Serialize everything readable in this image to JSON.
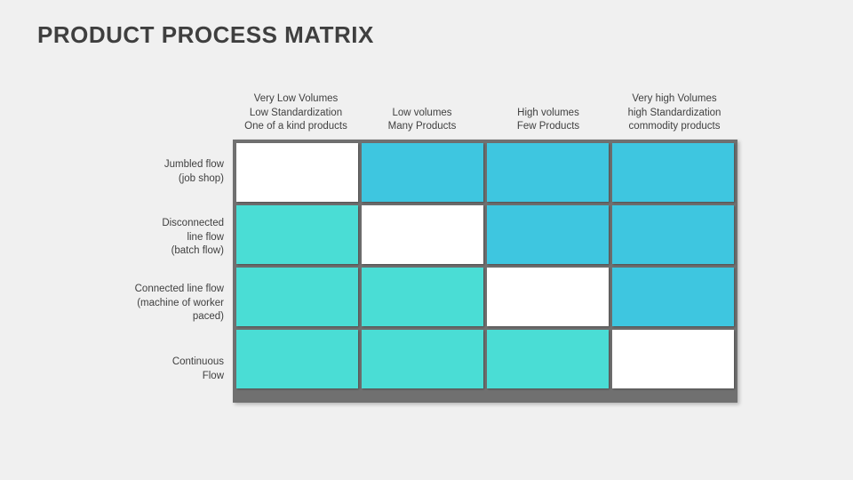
{
  "title": "PRODUCT PROCESS MATRIX",
  "columns": [
    {
      "l1": "Very Low Volumes",
      "l2": "Low Standardization",
      "l3": "One of a kind products"
    },
    {
      "l1": "Low volumes",
      "l2": "Many Products",
      "l3": ""
    },
    {
      "l1": "High volumes",
      "l2": "Few Products",
      "l3": ""
    },
    {
      "l1": "Very high Volumes",
      "l2": "high Standardization",
      "l3": "commodity products"
    }
  ],
  "rows": [
    {
      "l1": "Jumbled flow",
      "l2": "(job shop)",
      "l3": ""
    },
    {
      "l1": "Disconnected",
      "l2": "line flow",
      "l3": "(batch flow)"
    },
    {
      "l1": "Connected line flow",
      "l2": "(machine of worker",
      "l3": "paced)"
    },
    {
      "l1": "Continuous",
      "l2": "Flow",
      "l3": ""
    }
  ],
  "cells": [
    [
      "white",
      "cyan",
      "cyan",
      "cyan"
    ],
    [
      "teal",
      "white",
      "cyan",
      "cyan"
    ],
    [
      "teal",
      "teal",
      "white",
      "cyan"
    ],
    [
      "teal",
      "teal",
      "teal",
      "white"
    ]
  ],
  "colors": {
    "white": "#ffffff",
    "teal": "#4addd5",
    "cyan": "#3ec6e0",
    "frame": "#707070",
    "bg": "#f0f0f0"
  }
}
